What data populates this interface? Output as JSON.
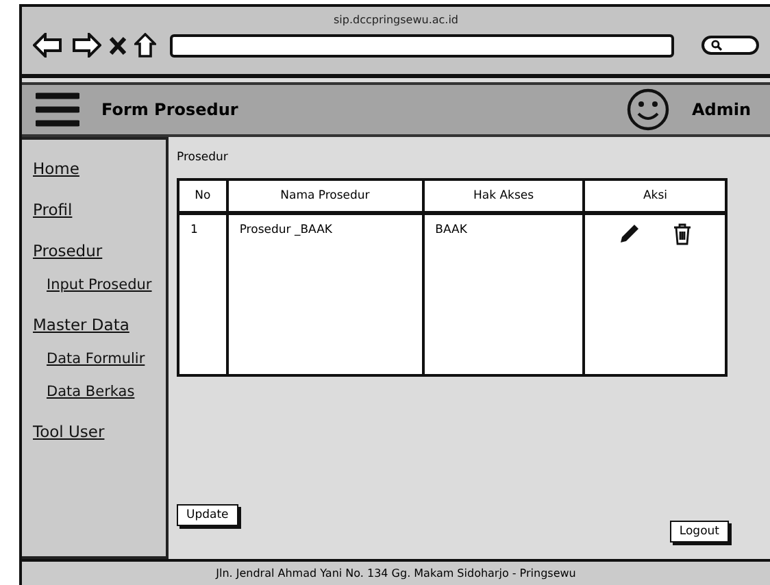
{
  "browser": {
    "url_title": "sip.dccpringsewu.ac.id"
  },
  "header": {
    "title": "Form Prosedur",
    "user": "Admin"
  },
  "sidebar": {
    "items": [
      {
        "label": "Home"
      },
      {
        "label": "Profil"
      },
      {
        "label": "Prosedur",
        "children": [
          {
            "label": "Input Prosedur"
          }
        ]
      },
      {
        "label": "Master Data",
        "children": [
          {
            "label": "Data Formulir"
          },
          {
            "label": "Data Berkas"
          }
        ]
      },
      {
        "label": "Tool User"
      }
    ]
  },
  "content": {
    "heading": "Prosedur",
    "table": {
      "columns": [
        "No",
        "Nama Prosedur",
        "Hak Akses",
        "Aksi"
      ],
      "rows": [
        {
          "no": "1",
          "nama": "Prosedur _BAAK",
          "hak": "BAAK"
        }
      ]
    },
    "buttons": [
      "Update",
      "Logout"
    ]
  },
  "status_bar": "Jln. Jendral Ahmad Yani No. 134 Gg. Makam Sidoharjo - Pringsewu"
}
